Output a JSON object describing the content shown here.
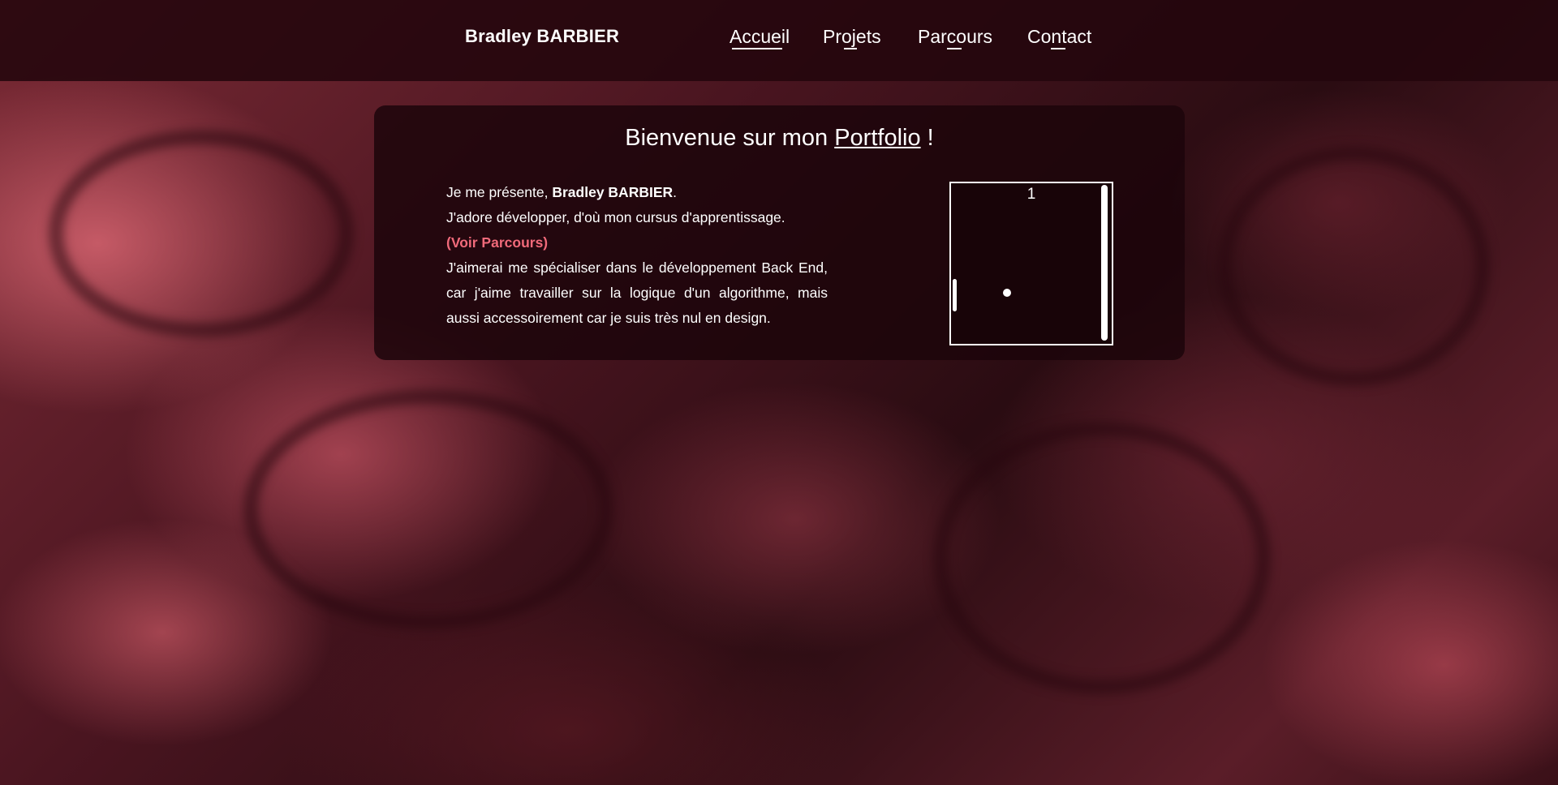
{
  "header": {
    "brand": "Bradley BARBIER",
    "nav": [
      "Accueil",
      "Projets",
      "Parcours",
      "Contact"
    ]
  },
  "main": {
    "title_prefix": "Bienvenue sur mon ",
    "title_link": "Portfolio",
    "title_suffix": " !",
    "intro_line1_prefix": "Je me présente, ",
    "intro_line1_name": "Bradley BARBIER",
    "intro_line1_suffix": ".",
    "intro_line2": "J'adore développer, d'où mon cursus d'apprentissage.",
    "intro_link": "(Voir Parcours)",
    "intro_line3": "J'aimerai me spécialiser dans le développement Back End, car j'aime travailler sur la logique d'un algorithme, mais aussi accessoirement car je suis très nul en design."
  },
  "game": {
    "score": "1"
  },
  "colors": {
    "accent": "#f06a7a",
    "nav_bg": "#23060c"
  }
}
